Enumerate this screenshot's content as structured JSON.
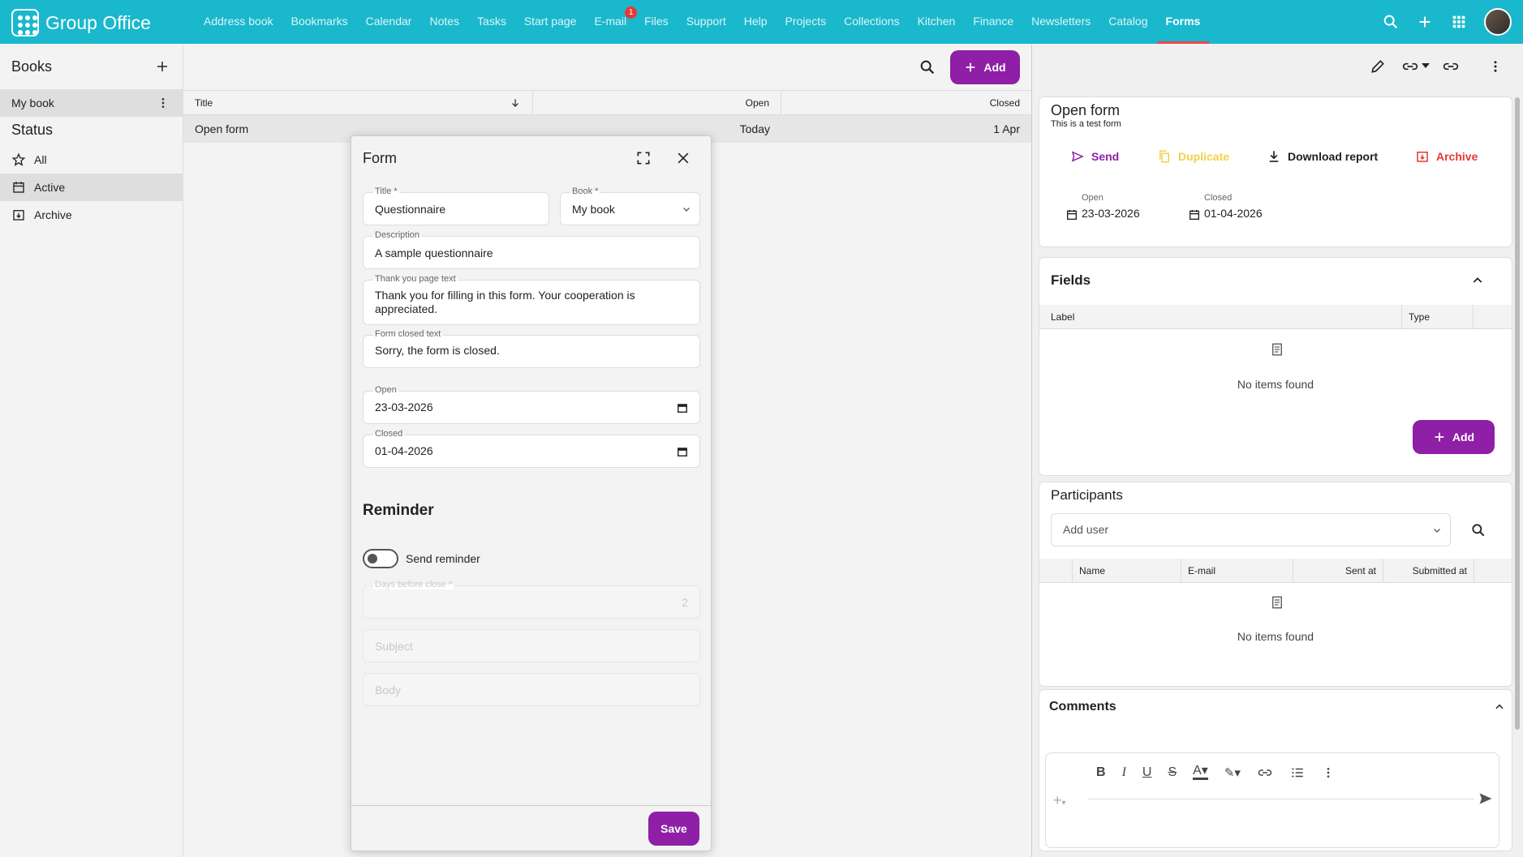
{
  "app": {
    "name": "Group Office"
  },
  "nav": {
    "items": [
      {
        "label": "Address book"
      },
      {
        "label": "Bookmarks"
      },
      {
        "label": "Calendar"
      },
      {
        "label": "Notes"
      },
      {
        "label": "Tasks"
      },
      {
        "label": "Start page"
      },
      {
        "label": "E-mail",
        "badge": "1"
      },
      {
        "label": "Files"
      },
      {
        "label": "Support"
      },
      {
        "label": "Help"
      },
      {
        "label": "Projects"
      },
      {
        "label": "Collections"
      },
      {
        "label": "Kitchen"
      },
      {
        "label": "Finance"
      },
      {
        "label": "Newsletters"
      },
      {
        "label": "Catalog"
      },
      {
        "label": "Forms",
        "active": true
      }
    ]
  },
  "sidebar": {
    "books_title": "Books",
    "books": [
      {
        "label": "My book"
      }
    ],
    "status_title": "Status",
    "status_items": [
      {
        "label": "All",
        "icon": "star-icon"
      },
      {
        "label": "Active",
        "icon": "calendar-icon",
        "selected": true
      },
      {
        "label": "Archive",
        "icon": "archive-icon"
      }
    ]
  },
  "main": {
    "add_label": "Add",
    "columns": {
      "title": "Title",
      "open": "Open",
      "closed": "Closed"
    },
    "rows": [
      {
        "title": "Open form",
        "open": "Today",
        "closed": "1 Apr"
      }
    ]
  },
  "dialog": {
    "title": "Form",
    "title_label": "Title *",
    "title_value": "Questionnaire",
    "book_label": "Book *",
    "book_value": "My book",
    "description_label": "Description",
    "description_value": "A sample questionnaire",
    "thanks_label": "Thank you page text",
    "thanks_line1": "Thank you for filling in this form. Your cooperation is",
    "thanks_line2": "appreciated.",
    "closed_text_label": "Form closed text",
    "closed_text_value": "Sorry, the form is closed.",
    "open_label": "Open",
    "open_value": "23-03-2026",
    "closed_label": "Closed",
    "closed_value": "01-04-2026",
    "reminder_title": "Reminder",
    "send_reminder_label": "Send reminder",
    "days_label": "Days before close *",
    "days_value": "2",
    "subject_placeholder": "Subject",
    "body_placeholder": "Body",
    "save_label": "Save"
  },
  "detail": {
    "title": "Open form",
    "subtitle": "This is a test form",
    "actions": {
      "send": "Send",
      "duplicate": "Duplicate",
      "download": "Download report",
      "archive": "Archive"
    },
    "open_label": "Open",
    "open_value": "23-03-2026",
    "closed_label": "Closed",
    "closed_value": "01-04-2026",
    "fields_title": "Fields",
    "fields_columns": {
      "label": "Label",
      "type": "Type"
    },
    "no_items": "No items found",
    "add_label": "Add",
    "participants_title": "Participants",
    "add_user_placeholder": "Add user",
    "participants_columns": {
      "name": "Name",
      "email": "E-mail",
      "sent_at": "Sent at",
      "submitted_at": "Submitted at"
    },
    "comments_title": "Comments"
  },
  "colors": {
    "topbar": "#1ab8cc",
    "accent": "#8e1fa6",
    "archive": "#e53935",
    "duplicate": "#f2d14a"
  }
}
